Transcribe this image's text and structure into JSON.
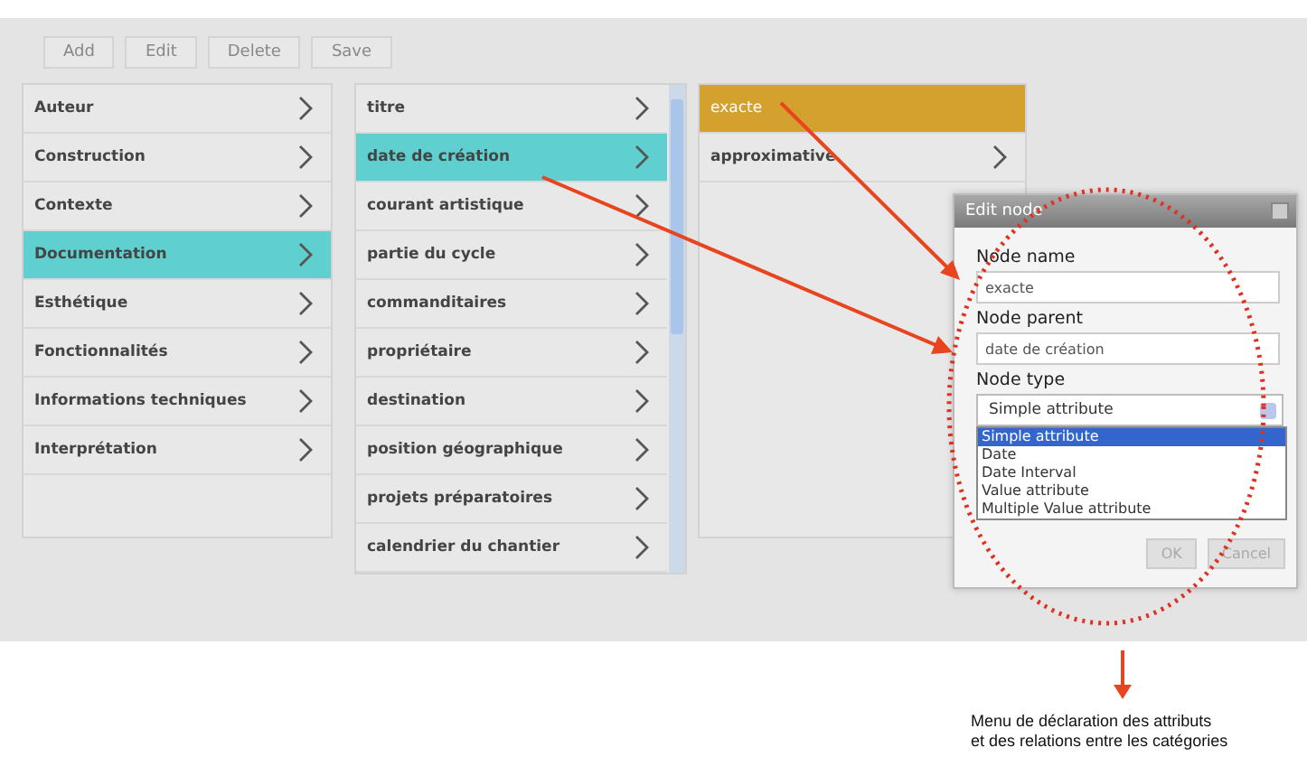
{
  "toolbar": [
    "Add",
    "Edit",
    "Delete",
    "Save"
  ],
  "columns": [
    {
      "items": [
        {
          "label": "Auteur",
          "selected": false,
          "kind": "branch"
        },
        {
          "label": "Construction",
          "selected": false,
          "kind": "branch"
        },
        {
          "label": "Contexte",
          "selected": false,
          "kind": "branch"
        },
        {
          "label": "Documentation",
          "selected": true,
          "kind": "branch"
        },
        {
          "label": "Esthétique",
          "selected": false,
          "kind": "branch"
        },
        {
          "label": "Fonctionnalités",
          "selected": false,
          "kind": "branch"
        },
        {
          "label": "Informations techniques",
          "selected": false,
          "kind": "branch"
        },
        {
          "label": "Interprétation",
          "selected": false,
          "kind": "branch"
        }
      ]
    },
    {
      "items": [
        {
          "label": "titre",
          "selected": false,
          "kind": "branch"
        },
        {
          "label": "date de création",
          "selected": true,
          "kind": "branch"
        },
        {
          "label": "courant artistique",
          "selected": false,
          "kind": "branch"
        },
        {
          "label": "partie du cycle",
          "selected": false,
          "kind": "branch"
        },
        {
          "label": "commanditaires",
          "selected": false,
          "kind": "branch"
        },
        {
          "label": "propriétaire",
          "selected": false,
          "kind": "branch"
        },
        {
          "label": "destination",
          "selected": false,
          "kind": "branch"
        },
        {
          "label": "position géographique",
          "selected": false,
          "kind": "branch"
        },
        {
          "label": "projets préparatoires",
          "selected": false,
          "kind": "branch"
        },
        {
          "label": "calendrier du chantier",
          "selected": false,
          "kind": "branch"
        }
      ]
    },
    {
      "items": [
        {
          "label": "exacte",
          "selected": true,
          "kind": "leaf"
        },
        {
          "label": "approximative",
          "selected": false,
          "kind": "branch"
        }
      ]
    }
  ],
  "dialog": {
    "title": "Edit node",
    "name_label": "Node name",
    "name_value": "exacte",
    "parent_label": "Node parent",
    "parent_value": "date de création",
    "type_label": "Node type",
    "type_value": "Simple attribute",
    "options": [
      {
        "label": "Simple attribute",
        "selected": true
      },
      {
        "label": "Date",
        "selected": false
      },
      {
        "label": "Date Interval",
        "selected": false
      },
      {
        "label": "Value attribute",
        "selected": false
      },
      {
        "label": "Multiple Value attribute",
        "selected": false
      }
    ],
    "buttons": [
      "OK",
      "Cancel"
    ]
  },
  "caption": [
    "Menu de déclaration des attributs",
    "et des relations entre les catégories"
  ]
}
